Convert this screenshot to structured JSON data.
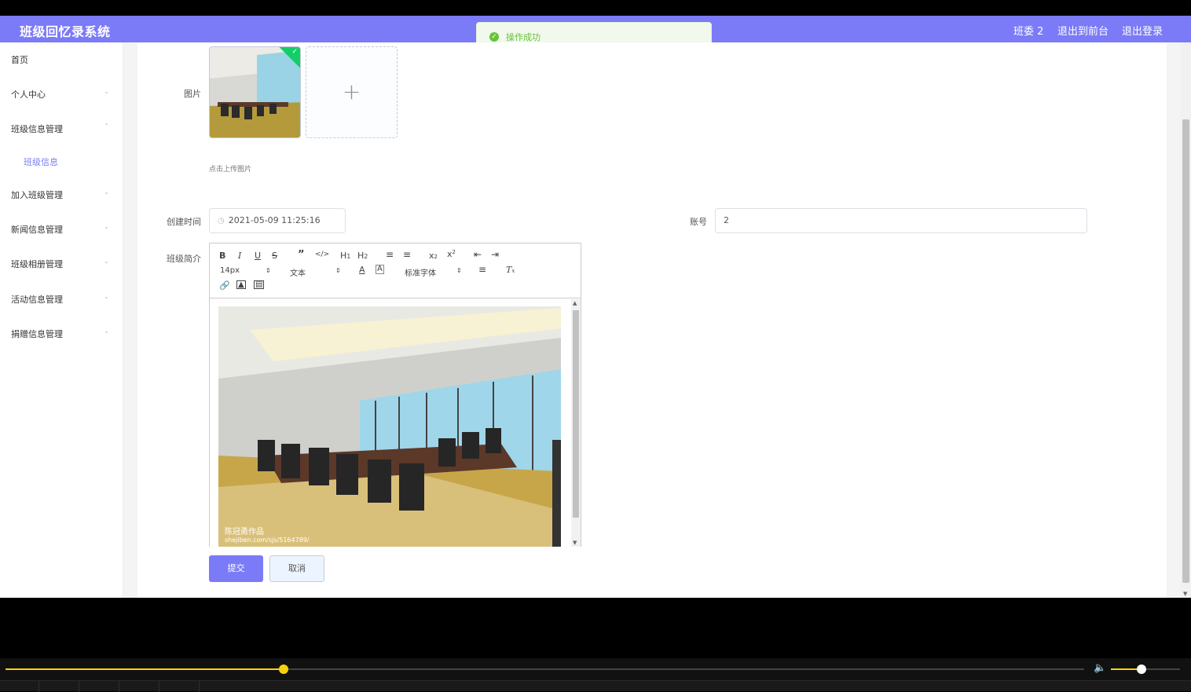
{
  "header": {
    "app_title": "班级回忆录系统",
    "user_label": "班委 2",
    "go_front_label": "退出到前台",
    "logout_label": "退出登录"
  },
  "toast": {
    "message": "操作成功"
  },
  "sidebar": {
    "items": [
      {
        "label": "首页"
      },
      {
        "label": "个人中心"
      },
      {
        "label": "班级信息管理"
      },
      {
        "label": "班级信息"
      },
      {
        "label": "加入班级管理"
      },
      {
        "label": "新闻信息管理"
      },
      {
        "label": "班级相册管理"
      },
      {
        "label": "活动信息管理"
      },
      {
        "label": "捐赠信息管理"
      }
    ]
  },
  "form": {
    "image_label": "图片",
    "upload_tip": "点击上传图片",
    "created_label": "创建时间",
    "created_value": "2021-05-09 11:25:16",
    "account_label": "账号",
    "account_value": "2",
    "intro_label": "班级简介",
    "submit_label": "提交",
    "cancel_label": "取消"
  },
  "editor": {
    "font_size": "14px",
    "header_select": "文本",
    "font_family": "标准字体",
    "image_watermark_line1": "陈冠勇作品",
    "image_watermark_line2": "shejiben.com/sjs/5164789/"
  },
  "player": {
    "progress": 0.258,
    "volume": 0.44
  },
  "colors": {
    "accent": "#7b7bf7",
    "success": "#67c23a",
    "seek": "#f5d30c"
  }
}
